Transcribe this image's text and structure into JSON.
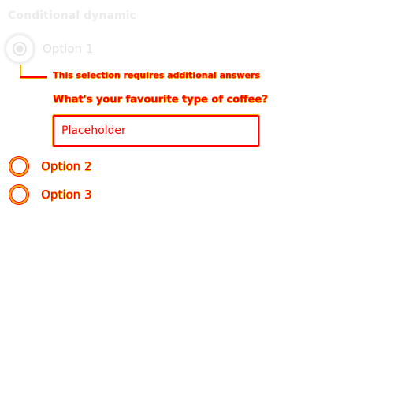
{
  "title": "Conditional dynamic",
  "options": [
    {
      "label": "Option 1",
      "selected": true
    },
    {
      "label": "Option 2",
      "selected": false
    },
    {
      "label": "Option 3",
      "selected": false
    }
  ],
  "conditional": {
    "notice": "This selection requires additional answers",
    "question": "What's your favourite type of coffee?",
    "input_placeholder": "Placeholder",
    "input_value": ""
  },
  "colors": {
    "faded": "#e2e2e2",
    "highlight_red": "#ff0000",
    "highlight_yellow": "#f2b400"
  },
  "icons": {
    "radio": "radio-button"
  }
}
